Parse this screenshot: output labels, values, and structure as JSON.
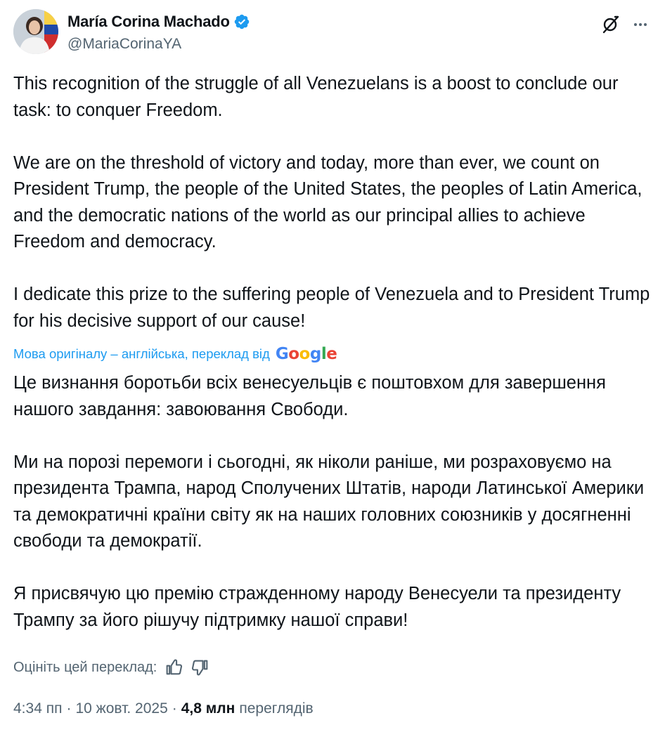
{
  "author": {
    "name": "María Corina Machado",
    "handle": "@MariaCorinaYA",
    "verified": true,
    "verified_color": "#1d9bf0"
  },
  "original_text": {
    "paragraphs": [
      "This recognition of the struggle of all Venezuelans is a boost to conclude our task: to conquer Freedom.",
      "We are on the threshold of victory and today, more than ever, we count on President Trump, the people of the United States, the peoples of Latin America, and the democratic nations of the world as our principal allies to achieve Freedom and democracy.",
      "I dedicate this prize to the suffering people of Venezuela and to President Trump for his decisive support of our cause!"
    ]
  },
  "translation": {
    "note": "Мова оригіналу – англійська, переклад від",
    "provider": "Google",
    "paragraphs": [
      "Це визнання боротьби всіх венесуельців є поштовхом для завершення нашого завдання: завоювання Свободи.",
      "Ми на порозі перемоги і сьогодні, як ніколи раніше, ми розраховуємо на президента Трампа, народ Сполучених Штатів, народи Латинської Америки та демократичні країни світу як на наших головних союзників у досягненні свободи та демократії.",
      "Я присвячую цю премію стражденному народу Венесуели та президенту Трампу за його рішучу підтримку нашої справи!"
    ],
    "rate_label": "Оцініть цей переклад:"
  },
  "meta": {
    "time": "4:34 пп",
    "separator": "·",
    "date": "10 жовт. 2025",
    "views_count": "4,8 млн",
    "views_label": "переглядів"
  },
  "colors": {
    "text": "#0f1419",
    "secondary": "#536471",
    "link": "#1d9bf0"
  },
  "icons": [
    "verified-badge-icon",
    "grok-icon",
    "more-icon",
    "thumbs-up-icon",
    "thumbs-down-icon",
    "google-logo"
  ]
}
